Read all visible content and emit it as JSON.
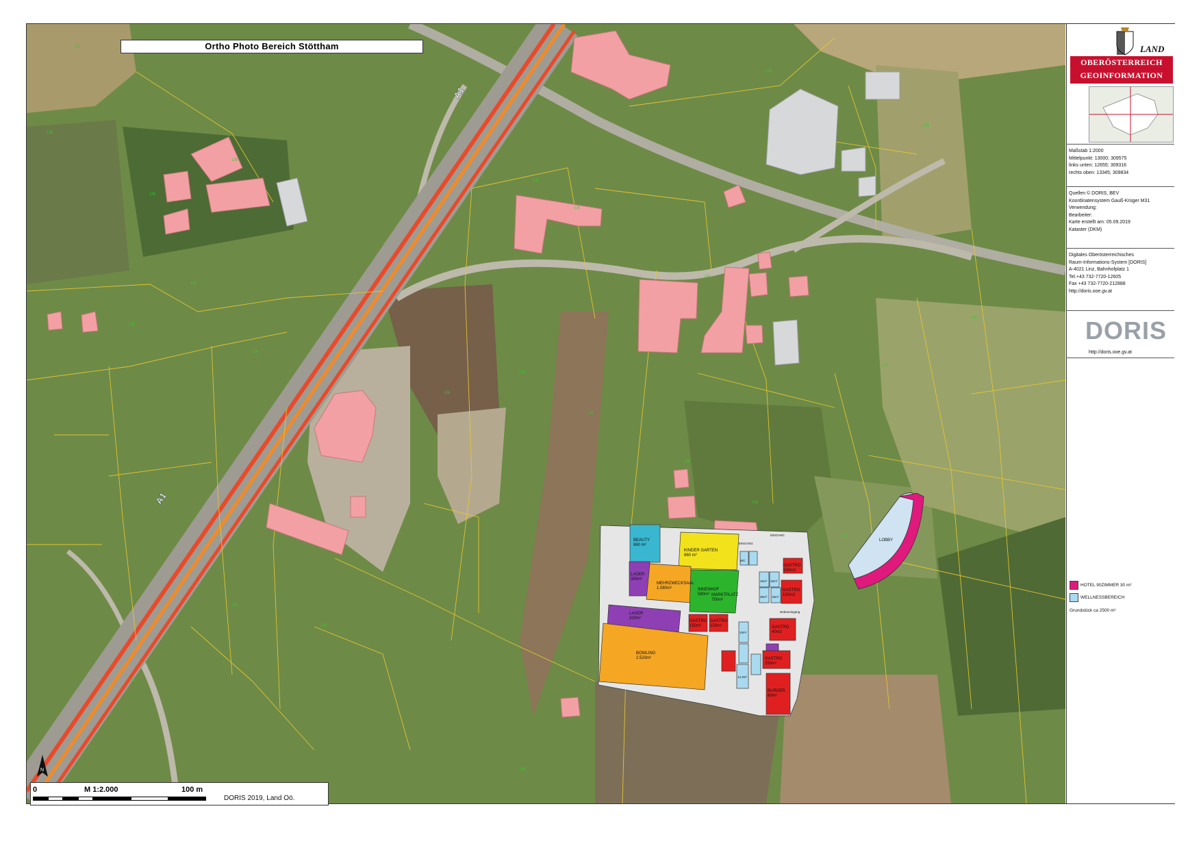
{
  "title": "Ortho Photo Bereich Stöttham",
  "logo": {
    "land": "LAND",
    "line1": "OBERÖSTERREICH",
    "line2": "GEOINFORMATION"
  },
  "info_block_1": [
    "Maßstab 1:2000",
    "Mittelpunkt: 13000; 309575",
    "links unten: 12655; 309316",
    "rechts oben: 13345; 309834"
  ],
  "info_block_2": [
    "Quellen © DORIS, BEV",
    "Koordinatensystem Gauß-Krüger M31",
    "Verwendung:",
    "Bearbeiter:",
    "Karte erstellt am: 05.09.2019",
    "Kataster (DKM)"
  ],
  "info_block_3": [
    "Digitales Oberösterreichisches",
    "Raum-Informations-System [DORIS]",
    "A-4021 Linz, Bahnhofplatz 1",
    "Tel.+43 732-7720-12605",
    "Fax +43 732-7720-212888",
    "http://doris.ooe.gv.at"
  ],
  "doris_logo": "DORIS",
  "doris_url": "http://doris.ooe.gv.at",
  "legend": [
    {
      "color": "#e0197d",
      "label": "HOTEL 90ZIMMER 30 m²"
    },
    {
      "color": "#a9daf0",
      "label": "WELLNESSBEREICH"
    }
  ],
  "legend_note": "Grundstück ca 2500 m²",
  "scalebar": {
    "left": "0",
    "mid": "M 1:2.000",
    "right": "100 m"
  },
  "copyright": "DORIS 2019, Land Oö.",
  "north_label": "N",
  "road_labels": [
    "A1",
    "A1"
  ],
  "plan_rooms": [
    {
      "label": "BEAUTY\n860 m²",
      "color": "#3ab7d0"
    },
    {
      "label": "KINDER GARTEN\n860 m²",
      "color": "#f2e21b"
    },
    {
      "label": "LAGER\n350m²",
      "color": "#8e3fb4"
    },
    {
      "label": "MEHRZWECKSAAL\n1.080m²",
      "color": "#f5a623"
    },
    {
      "label": "INNENHOF\n580m²",
      "color": "#2cb52c"
    },
    {
      "label": "LAGER\n320m²",
      "color": "#8e3fb4"
    },
    {
      "label": "MARKTPLATZ\n750m²",
      "color": "#e6e6e6"
    },
    {
      "label": "BOWLING\n2.520m²",
      "color": "#f5a623"
    },
    {
      "label": "GASTRO\n150m²",
      "color": "#e02020"
    },
    {
      "label": "GASTRO\n150m²",
      "color": "#e02020"
    },
    {
      "label": "GASTRO\n150m2",
      "color": "#e02020"
    },
    {
      "label": "GASTRO\n150m2",
      "color": "#e02020"
    },
    {
      "label": "GASTRO\n40m2",
      "color": "#e02020"
    },
    {
      "label": "GASTRO\n250m²",
      "color": "#e02020"
    },
    {
      "label": "BURGER\n80m²",
      "color": "#e02020"
    },
    {
      "label": "LOBBY",
      "color": "#cfe3f2"
    }
  ],
  "plan_small_labels": [
    "WC",
    "15m²",
    "15m²",
    "35m²",
    "15m²",
    "10m²",
    "14.3m²",
    "EINGANG",
    "EINGANG",
    "Nebeneingang"
  ],
  "parcel_labels": [
    "LN",
    "LN",
    "LN",
    "LN",
    "LN",
    "LN",
    "LN",
    "LN",
    "LN",
    "LN",
    "LN",
    "LN",
    "LN",
    "LN",
    "LN",
    "LN",
    "LN",
    "LN",
    "LN",
    "LN",
    "LN",
    "LN",
    "LN",
    "LN"
  ],
  "watermark": "DORIS"
}
